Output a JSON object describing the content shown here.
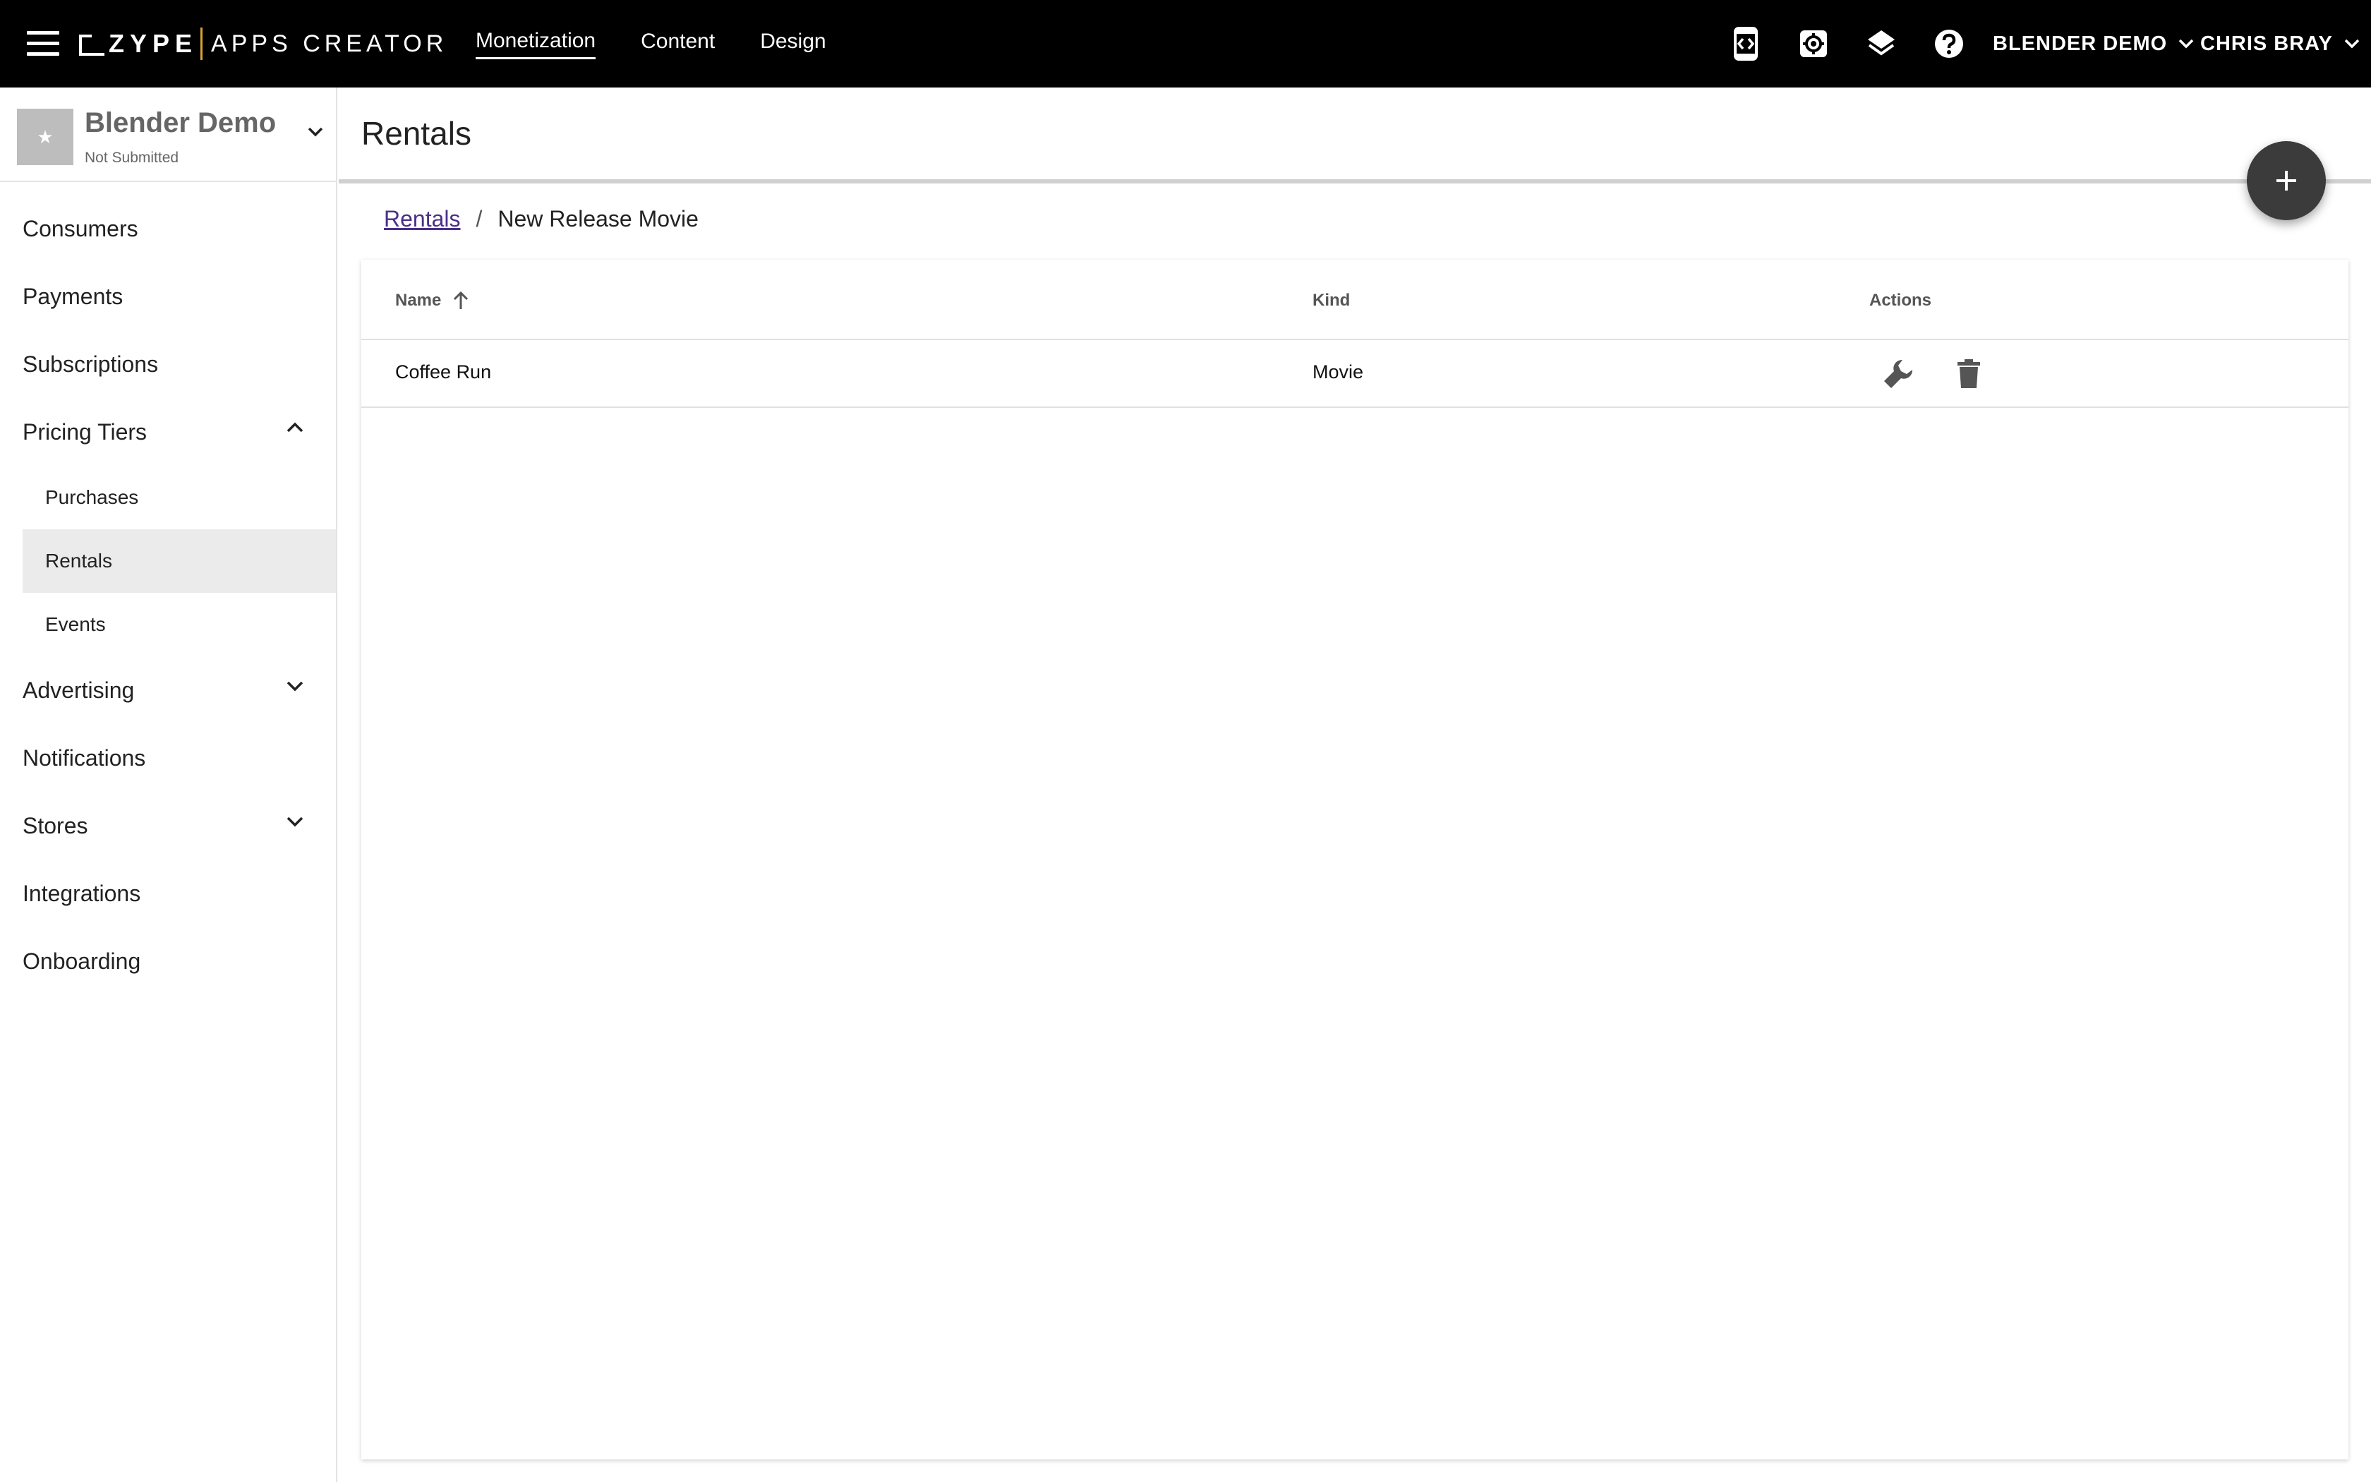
{
  "topbar": {
    "logo_brand": "ZYPE",
    "logo_product": "APPS CREATOR",
    "nav": [
      {
        "label": "Monetization",
        "active": true
      },
      {
        "label": "Content",
        "active": false
      },
      {
        "label": "Design",
        "active": false
      }
    ],
    "icons": [
      "device-code-icon",
      "settings-gear-icon",
      "layers-icon",
      "help-icon"
    ],
    "app_menu": "BLENDER DEMO",
    "user_menu": "CHRIS BRAY"
  },
  "sidebar": {
    "app_name": "Blender Demo",
    "app_status": "Not Submitted",
    "items": [
      {
        "label": "Consumers"
      },
      {
        "label": "Payments"
      },
      {
        "label": "Subscriptions"
      },
      {
        "label": "Pricing Tiers",
        "expanded": true,
        "children": [
          {
            "label": "Purchases"
          },
          {
            "label": "Rentals",
            "selected": true
          },
          {
            "label": "Events"
          }
        ]
      },
      {
        "label": "Advertising",
        "expanded": false
      },
      {
        "label": "Notifications"
      },
      {
        "label": "Stores",
        "expanded": false
      },
      {
        "label": "Integrations"
      },
      {
        "label": "Onboarding"
      }
    ]
  },
  "main": {
    "title": "Rentals",
    "breadcrumb": {
      "link": "Rentals",
      "separator": "/",
      "current": "New Release Movie"
    },
    "table": {
      "columns": [
        "Name",
        "Kind",
        "Actions"
      ],
      "rows": [
        {
          "name": "Coffee Run",
          "kind": "Movie"
        }
      ]
    }
  },
  "colors": {
    "topbar_bg": "#000000",
    "logo_accent": "#d8a530",
    "link": "#4a2f8a",
    "fab_bg": "#3b3b3b",
    "selected_bg": "#ebebeb"
  }
}
